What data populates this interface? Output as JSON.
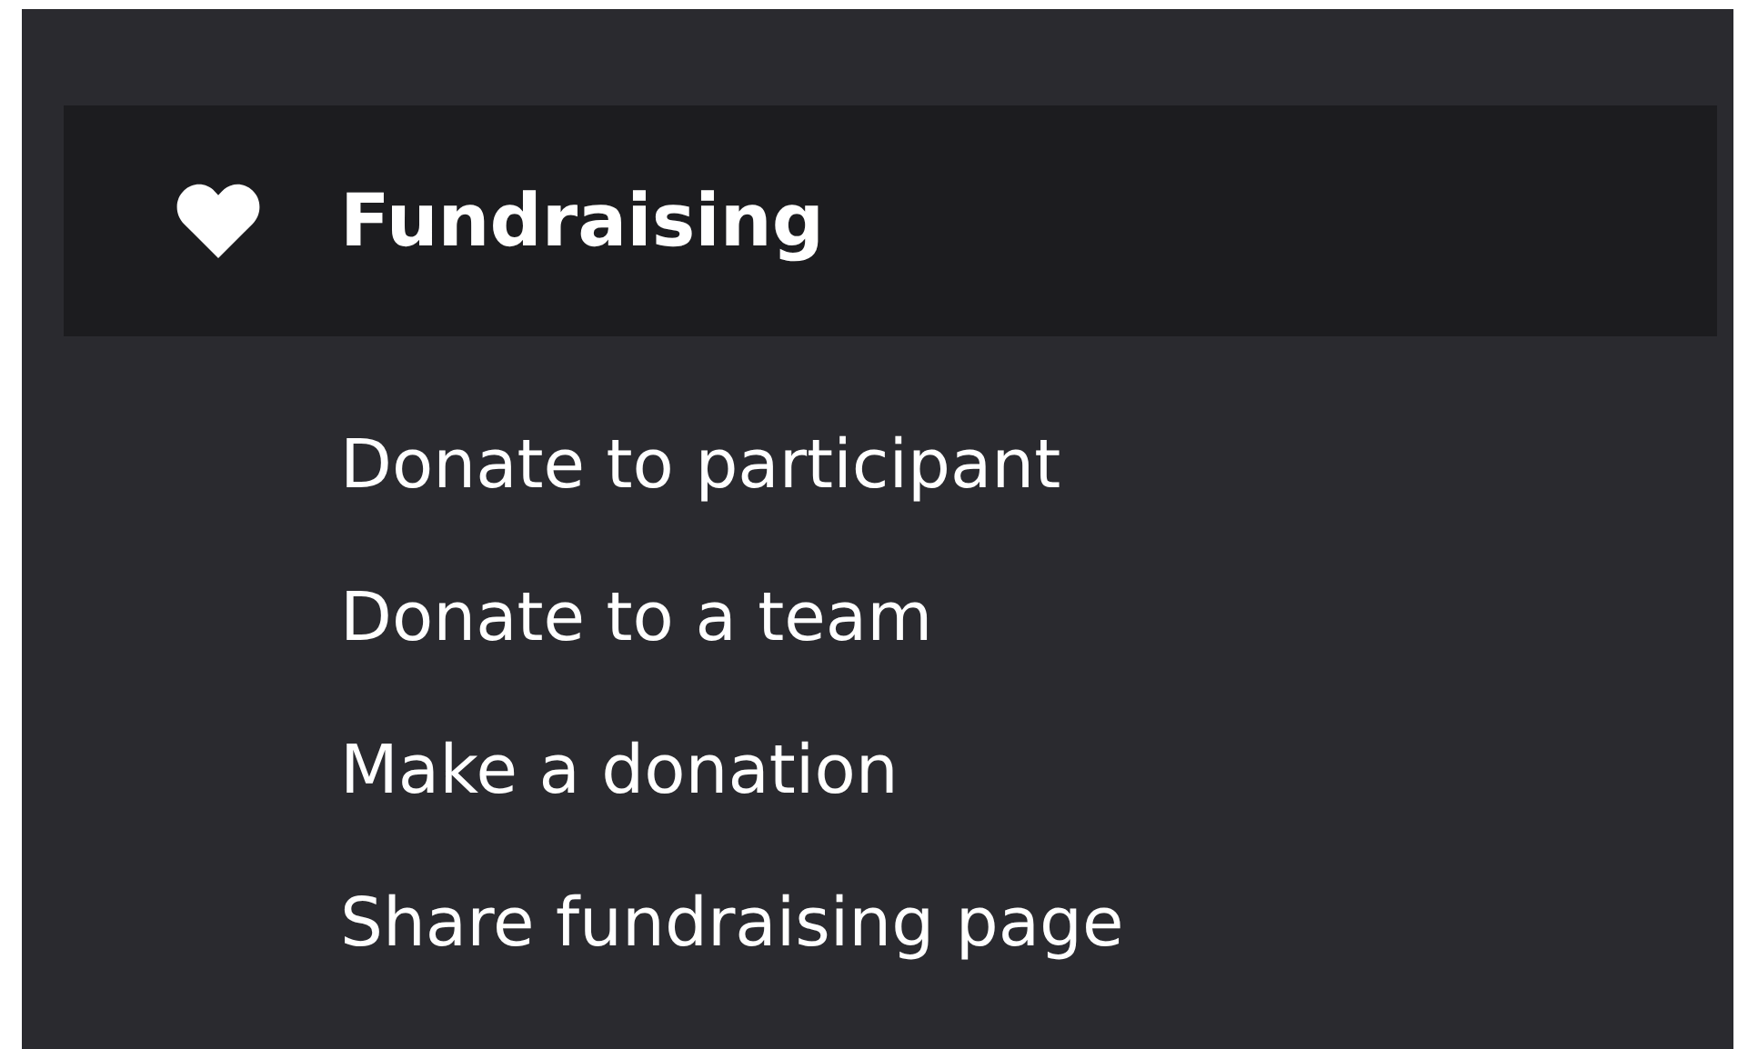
{
  "menu": {
    "title": "Fundraising",
    "items": [
      {
        "label": "Donate to participant"
      },
      {
        "label": "Donate to a team"
      },
      {
        "label": "Make a donation"
      },
      {
        "label": "Share fundraising page"
      }
    ]
  }
}
